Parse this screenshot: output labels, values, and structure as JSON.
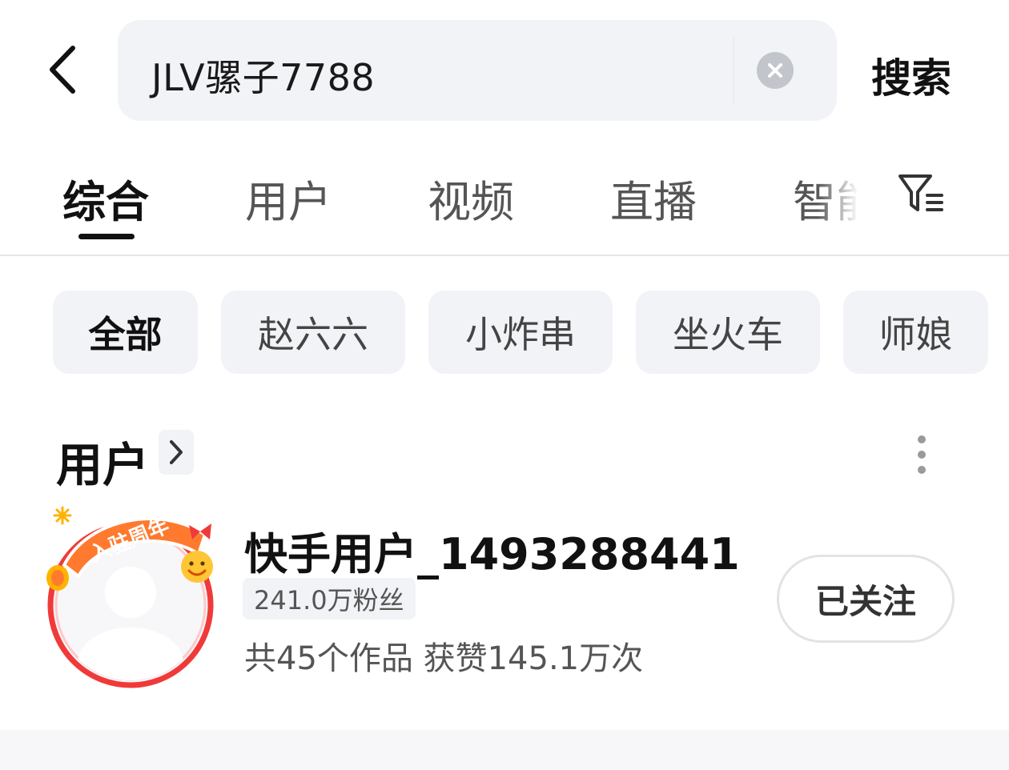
{
  "search": {
    "query": "JLV骡子7788",
    "submit_label": "搜索",
    "back_icon": "chevron-left-icon",
    "clear_icon": "close-icon"
  },
  "tabs": [
    {
      "label": "综合",
      "active": true
    },
    {
      "label": "用户",
      "active": false
    },
    {
      "label": "视频",
      "active": false
    },
    {
      "label": "直播",
      "active": false
    },
    {
      "label": "智能",
      "active": false
    }
  ],
  "filter_icon": "filter-icon",
  "chips": [
    {
      "label": "全部",
      "active": true
    },
    {
      "label": "赵六六",
      "active": false
    },
    {
      "label": "小炸串",
      "active": false
    },
    {
      "label": "坐火车",
      "active": false
    },
    {
      "label": "师娘",
      "active": false
    }
  ],
  "user_section": {
    "title": "用户",
    "more_icon": "more-vertical-icon"
  },
  "user": {
    "name": "快手用户_1493288441",
    "fans": "241.0万粉丝",
    "stats": "共45个作品 获赞145.1万次",
    "follow_label": "已关注",
    "avatar_badge_text": "入驻周年"
  },
  "colors": {
    "search_bg": "#f2f3f7",
    "avatar_ring": "#f03a3a",
    "badge_orange": "#ff7a2e"
  }
}
